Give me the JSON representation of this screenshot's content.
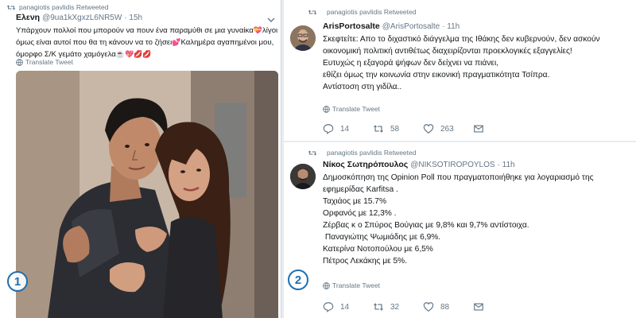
{
  "left_tweet": {
    "retweet_text": "panagiotis pavlidis Retweeted",
    "name": "Ελενη",
    "handle": "@9ua1kXgxzL6NR5W",
    "time": "· 15h",
    "lines": [
      "Υπάρχουν πολλοί που μπορούν να πουν ένα παραμύθι σε μια γυναίκα",
      "όμως είναι αυτοί που θα τη κάνουν να το ζήσει",
      "όμορφο Σ/Κ γεμάτο χαμόγελα"
    ],
    "line1_tail": "λίγοι",
    "line2_tail": "Καλημέρα αγαπημένοι μου,",
    "translate": "Translate Tweet",
    "badge": "1"
  },
  "tweet_a": {
    "retweet_text": "panagiotis pavlidis Retweeted",
    "name": "ArisPortosalte",
    "handle": "@ArisPortosalte",
    "time": "· 11h",
    "lines": [
      "Σκεφτείτε: Απο το διχαστικό διάγγελμα της Ιθάκης δεν κυβερνούν, δεν ασκούν",
      "οικονομική πολιτική αντιθέτως διαχειρίζονται προεκλογικές εξαγγελίες!",
      "Ευτυχώς η εξαγορά ψήφων δεν δείχνει να πιάνει,",
      "εθίζει όμως την κοινωνία στην εικονική πραγματικότητα Τσίπρα.",
      "Αντίστοση στη γιδίλα.."
    ],
    "translate": "Translate Tweet",
    "replies": "14",
    "retweets": "58",
    "likes": "263"
  },
  "tweet_b": {
    "retweet_text": "panagiotis pavlidis Retweeted",
    "name": "Νίκος Σωτηρόπουλος",
    "handle": "@NIKSOTIROPOYLOS",
    "time": "· 11h",
    "lines": [
      "Δημοσκόπηση της Opinion Poll που πραγματοποιήθηκε για λογαριασμό της",
      "εφημερίδας Karfitsa .",
      "Ταχιάος με 15.7%",
      "Ορφανός με 12,3% .",
      "Ζέρβας κ ο Σπύρος Βούγιας με 9,8% και 9,7% αντίστοιχα.",
      " Παναγιώτης Ψωμιάδης με 6,9%.",
      "Κατερίνα Νοτοπούλου με 6,5%",
      "Πέτρος Λεκάκης με 5%."
    ],
    "translate": "Translate Tweet",
    "replies": "14",
    "retweets": "32",
    "likes": "88",
    "badge": "2"
  },
  "colors": {
    "text": "#14171a",
    "secondary": "#657786",
    "badge": "#1f6fb0",
    "heart": "#d0243f"
  },
  "icons": [
    "retweet-icon",
    "globe-icon",
    "reply-icon",
    "heart-icon",
    "mail-icon",
    "chevron-down-icon"
  ]
}
